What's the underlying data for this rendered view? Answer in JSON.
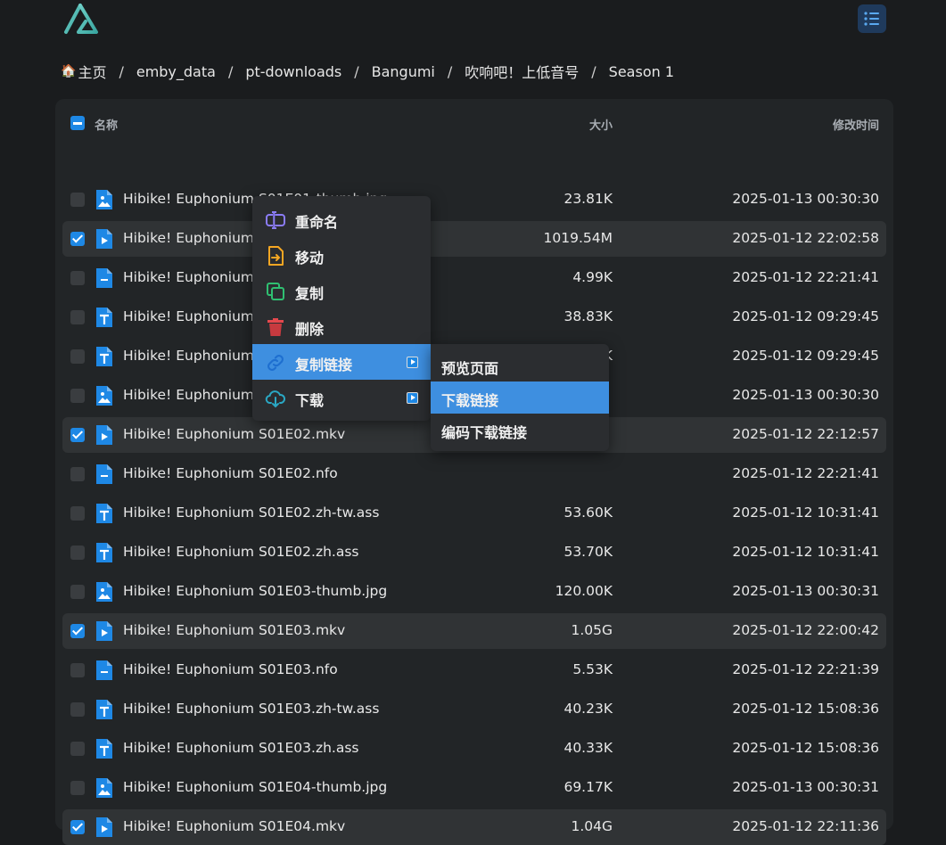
{
  "header": {
    "logo": "alist-logo-icon",
    "menu_icon": "list-icon",
    "accent": "#1e88e5"
  },
  "breadcrumb": [
    {
      "label": "主页",
      "icon": "home-icon"
    },
    {
      "label": "emby_data"
    },
    {
      "label": "pt-downloads"
    },
    {
      "label": "Bangumi"
    },
    {
      "label": "吹响吧！上低音号"
    },
    {
      "label": "Season 1"
    }
  ],
  "table": {
    "headers": {
      "name": "名称",
      "size": "大小",
      "modified": "修改时间"
    },
    "rows": [
      {
        "name": "Hibike! Euphonium S01E01-thumb.jpg",
        "size": "23.81K",
        "modified": "2025-01-13 00:30:30",
        "type": "image",
        "selected": false
      },
      {
        "name": "Hibike! Euphonium S01E01.mkv",
        "name_visible": "Hibike! Euphonium S01E01.mkv",
        "size": "1019.54M",
        "modified": "2025-01-12 22:02:58",
        "type": "video",
        "selected": true
      },
      {
        "name": "Hibike! Euphonium S01E01.nfo",
        "size": "4.99K",
        "modified": "2025-01-12 22:21:41",
        "type": "doc",
        "selected": false
      },
      {
        "name": "Hibike! Euphonium S01E01.zh-tw.ass",
        "size": "38.83K",
        "modified": "2025-01-12 09:29:45",
        "type": "text",
        "selected": false
      },
      {
        "name": "Hibike! Euphonium S01E01.zh.ass",
        "size": "38.93K",
        "modified": "2025-01-12 09:29:45",
        "type": "text",
        "selected": false
      },
      {
        "name": "Hibike! Euphonium S01E02-thumb.jpg",
        "size": "",
        "modified": "2025-01-13 00:30:30",
        "type": "image",
        "selected": false
      },
      {
        "name": "Hibike! Euphonium S01E02.mkv",
        "size": "",
        "modified": "2025-01-12 22:12:57",
        "type": "video",
        "selected": true
      },
      {
        "name": "Hibike! Euphonium S01E02.nfo",
        "size": "",
        "modified": "2025-01-12 22:21:41",
        "type": "doc",
        "selected": false
      },
      {
        "name": "Hibike! Euphonium S01E02.zh-tw.ass",
        "size": "53.60K",
        "modified": "2025-01-12 10:31:41",
        "type": "text",
        "selected": false
      },
      {
        "name": "Hibike! Euphonium S01E02.zh.ass",
        "size": "53.70K",
        "modified": "2025-01-12 10:31:41",
        "type": "text",
        "selected": false
      },
      {
        "name": "Hibike! Euphonium S01E03-thumb.jpg",
        "size": "120.00K",
        "modified": "2025-01-13 00:30:31",
        "type": "image",
        "selected": false
      },
      {
        "name": "Hibike! Euphonium S01E03.mkv",
        "size": "1.05G",
        "modified": "2025-01-12 22:00:42",
        "type": "video",
        "selected": true
      },
      {
        "name": "Hibike! Euphonium S01E03.nfo",
        "size": "5.53K",
        "modified": "2025-01-12 22:21:39",
        "type": "doc",
        "selected": false
      },
      {
        "name": "Hibike! Euphonium S01E03.zh-tw.ass",
        "size": "40.23K",
        "modified": "2025-01-12 15:08:36",
        "type": "text",
        "selected": false
      },
      {
        "name": "Hibike! Euphonium S01E03.zh.ass",
        "size": "40.33K",
        "modified": "2025-01-12 15:08:36",
        "type": "text",
        "selected": false
      },
      {
        "name": "Hibike! Euphonium S01E04-thumb.jpg",
        "size": "69.17K",
        "modified": "2025-01-13 00:30:31",
        "type": "image",
        "selected": false
      },
      {
        "name": "Hibike! Euphonium S01E04.mkv",
        "size": "1.04G",
        "modified": "2025-01-12 22:11:36",
        "type": "video",
        "selected": true
      }
    ]
  },
  "context_menu": {
    "items": [
      {
        "label": "重命名",
        "icon": "rename-icon"
      },
      {
        "label": "移动",
        "icon": "move-file-icon"
      },
      {
        "label": "复制",
        "icon": "copy-icon"
      },
      {
        "label": "删除",
        "icon": "trash-icon"
      },
      {
        "label": "复制链接",
        "icon": "link-icon",
        "submenu": true,
        "active": true
      },
      {
        "label": "下载",
        "icon": "cloud-download-icon",
        "submenu": true
      }
    ],
    "submenu": [
      {
        "label": "预览页面"
      },
      {
        "label": "下载链接",
        "active": true
      },
      {
        "label": "编码下载链接"
      }
    ]
  }
}
